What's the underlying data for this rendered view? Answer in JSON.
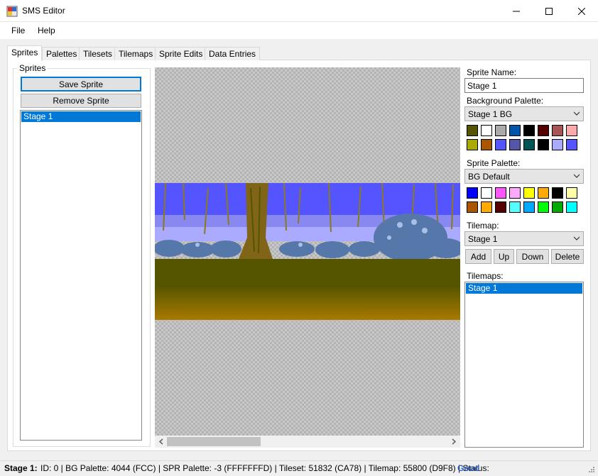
{
  "window": {
    "title": "SMS Editor",
    "controls": [
      "minimize",
      "maximize",
      "close"
    ]
  },
  "menu": [
    "File",
    "Help"
  ],
  "tabs": [
    {
      "label": "Sprites",
      "active": true
    },
    {
      "label": "Palettes"
    },
    {
      "label": "Tilesets"
    },
    {
      "label": "Tilemaps"
    },
    {
      "label": "Sprite Edits"
    },
    {
      "label": "Data Entries"
    }
  ],
  "sprites_group": {
    "title": "Sprites",
    "save_label": "Save Sprite",
    "remove_label": "Remove Sprite",
    "items": [
      "Stage 1"
    ],
    "selected": "Stage 1"
  },
  "props": {
    "sprite_name_label": "Sprite Name:",
    "sprite_name_value": "Stage 1",
    "bg_palette_label": "Background Palette:",
    "bg_palette_value": "Stage 1 BG",
    "bg_colors": [
      "#555500",
      "#ffffff",
      "#aaaaaa",
      "#0055aa",
      "#000000",
      "#550000",
      "#aa5555",
      "#ffaaaa",
      "#aaaa00",
      "#aa5500",
      "#5555ff",
      "#5555aa",
      "#005555",
      "#000000",
      "#aaaaff",
      "#5555ff"
    ],
    "spr_palette_label": "Sprite Palette:",
    "spr_palette_value": "BG Default",
    "spr_colors": [
      "#0000ff",
      "#ffffff",
      "#ff55ff",
      "#ffaaff",
      "#ffff00",
      "#ffaa00",
      "#000000",
      "#ffffaa",
      "#aa5500",
      "#ffaa00",
      "#550000",
      "#55ffff",
      "#00aaff",
      "#00ff00",
      "#00aa00",
      "#00ffff"
    ],
    "tilemap_label": "Tilemap:",
    "tilemap_value": "Stage 1",
    "add_label": "Add",
    "up_label": "Up",
    "down_label": "Down",
    "delete_label": "Delete",
    "tilemaps_label": "Tilemaps:",
    "tilemaps_items": [
      "Stage 1"
    ]
  },
  "status": {
    "name": "Stage 1:",
    "details": "ID: 0 | BG Palette: 4044 (FCC) | SPR Palette: -3 (FFFFFFFD) | Tileset: 51832 (CA78) | Tilemap: 55800 (D9F8) | Status:",
    "state": "Good"
  }
}
